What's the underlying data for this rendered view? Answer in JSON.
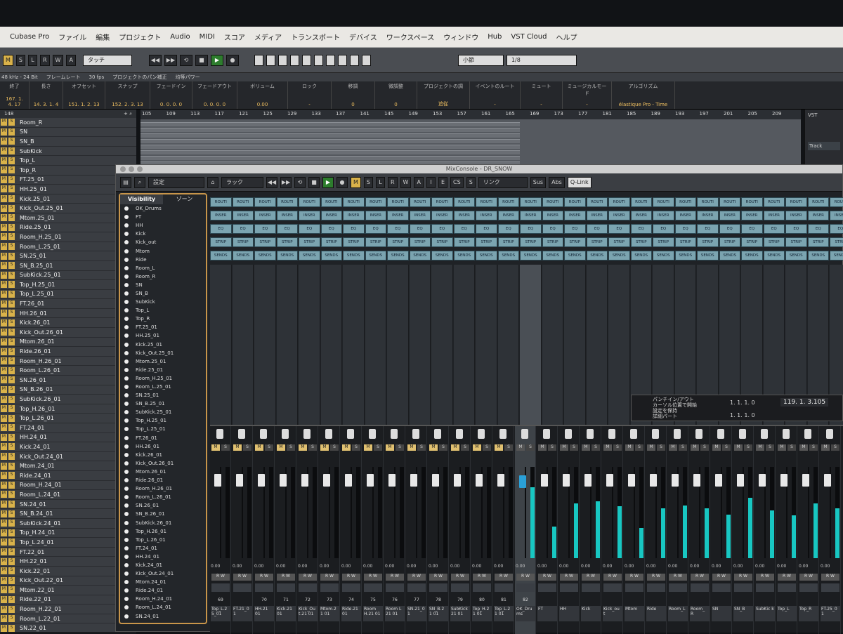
{
  "menubar": {
    "items": [
      "Cubase Pro",
      "ファイル",
      "編集",
      "プロジェクト",
      "Audio",
      "MIDI",
      "スコア",
      "メディア",
      "トランスポート",
      "デバイス",
      "ワークスペース",
      "ウィンドウ",
      "Hub",
      "VST Cloud",
      "ヘルプ"
    ]
  },
  "toolbar": {
    "msrwa": [
      "M",
      "S",
      "L",
      "R",
      "W",
      "A"
    ],
    "mode": "タッチ",
    "quantize": "小節",
    "grid": "1/8"
  },
  "infoline": {
    "items": [
      "48 kHz - 24 Bit",
      "フレームレート",
      "30 fps",
      "プロジェクトのパン補正",
      "均等パワー"
    ]
  },
  "eventline": {
    "cells": [
      {
        "label": "終了",
        "value": "167. 1. 4. 17"
      },
      {
        "label": "長さ",
        "value": "14. 3. 1. 4"
      },
      {
        "label": "オフセット",
        "value": "151. 1. 2. 13"
      },
      {
        "label": "スナップ",
        "value": "152. 2. 3. 13"
      },
      {
        "label": "フェードイン",
        "value": "0. 0. 0. 0"
      },
      {
        "label": "フェードアウト",
        "value": "0. 0. 0. 0"
      },
      {
        "label": "ボリューム",
        "value": "0.00"
      },
      {
        "label": "ロック",
        "value": "-"
      },
      {
        "label": "移調",
        "value": "0"
      },
      {
        "label": "微調整",
        "value": "0"
      },
      {
        "label": "プロジェクトの調",
        "value": "追従"
      },
      {
        "label": "イベントのルート",
        "value": "-"
      },
      {
        "label": "ミュート",
        "value": "-"
      },
      {
        "label": "ミュージカルモード",
        "value": "-"
      },
      {
        "label": "アルゴリズム",
        "value": "élastique Pro - Time"
      }
    ]
  },
  "tracklist": {
    "count": "148",
    "tracks": [
      "Room_R",
      "SN",
      "SN_B",
      "SubKick",
      "Top_L",
      "Top_R",
      "FT.25_01",
      "HH.25_01",
      "Kick.25_01",
      "Kick_Out.25_01",
      "Mtom.25_01",
      "Ride.25_01",
      "Room_H.25_01",
      "Room_L.25_01",
      "SN.25_01",
      "SN_B.25_01",
      "SubKick.25_01",
      "Top_H.25_01",
      "Top_L.25_01",
      "FT.26_01",
      "HH.26_01",
      "Kick.26_01",
      "Kick_Out.26_01",
      "Mtom.26_01",
      "Ride.26_01",
      "Room_H.26_01",
      "Room_L.26_01",
      "SN.26_01",
      "SN_B.26_01",
      "SubKick.26_01",
      "Top_H.26_01",
      "Top_L.26_01",
      "FT.24_01",
      "HH.24_01",
      "Kick.24_01",
      "Kick_Out.24_01",
      "Mtom.24_01",
      "Ride.24_01",
      "Room_H.24_01",
      "Room_L.24_01",
      "SN.24_01",
      "SN_B.24_01",
      "SubKick.24_01",
      "Top_H.24_01",
      "Top_L.24_01",
      "FT.22_01",
      "HH.22_01",
      "Kick.22_01",
      "Kick_Out.22_01",
      "Mtom.22_01",
      "Ride.22_01",
      "Room_H.22_01",
      "Room_L.22_01",
      "SN.22_01"
    ]
  },
  "ruler": {
    "bars": [
      "105",
      "109",
      "113",
      "117",
      "121",
      "125",
      "129",
      "133",
      "137",
      "141",
      "145",
      "149",
      "153",
      "157",
      "161",
      "165",
      "169",
      "173",
      "177",
      "181",
      "185",
      "189",
      "193",
      "197",
      "201",
      "205",
      "209"
    ]
  },
  "rightzone": {
    "title": "VST",
    "button": "Track"
  },
  "mixconsole": {
    "title": "MixConsole - DR_SNOW",
    "toolbar": {
      "settings": "設定",
      "rack": "ラック",
      "btns": [
        "M",
        "S",
        "L",
        "R",
        "W",
        "A"
      ],
      "ies": [
        "I",
        "E",
        "CS",
        "S"
      ],
      "link": "リンク",
      "sus": "Sus",
      "abs": "Abs",
      "qlink": "Q-Link"
    },
    "vis_tabs": [
      "Visibility",
      "ゾーン"
    ],
    "vis_items": [
      "OK_Drums",
      "FT",
      "HH",
      "Kick",
      "Kick_out",
      "Mtom",
      "Ride",
      "Room_L",
      "Room_R",
      "SN",
      "SN_B",
      "SubKick",
      "Top_L",
      "Top_R",
      "FT.25_01",
      "HH.25_01",
      "Kick.25_01",
      "Kick_Out.25_01",
      "Mtom.25_01",
      "Ride.25_01",
      "Room_H.25_01",
      "Room_L.25_01",
      "SN.25_01",
      "SN_B.25_01",
      "SubKick.25_01",
      "Top_H.25_01",
      "Top_L.25_01",
      "FT.26_01",
      "HH.26_01",
      "Kick.26_01",
      "Kick_Out.26_01",
      "Mtom.26_01",
      "Ride.26_01",
      "Room_H.26_01",
      "Room_L.26_01",
      "SN.26_01",
      "SN_B.26_01",
      "SubKick.26_01",
      "Top_H.26_01",
      "Top_L.26_01",
      "FT.24_01",
      "HH.24_01",
      "Kick.24_01",
      "Kick_Out.24_01",
      "Mtom.24_01",
      "Ride.24_01",
      "Room_H.24_01",
      "Room_L.24_01",
      "SN.24_01"
    ],
    "racks": [
      "ROUTI",
      "INSER",
      "EQ",
      "STRIP",
      "SENDS"
    ],
    "channels": [
      {
        "num": "69",
        "name": "Top_L.2 5_01",
        "val": "0.00",
        "meter": 0
      },
      {
        "num": "",
        "name": "FT.21_0 1",
        "val": "0.00",
        "meter": 0
      },
      {
        "num": "70",
        "name": "HH.21 01",
        "val": "0.00",
        "meter": 0
      },
      {
        "num": "71",
        "name": "Kick.21 01",
        "val": "0.00",
        "meter": 0
      },
      {
        "num": "72",
        "name": "Kick_Ou t.21 01",
        "val": "0.00",
        "meter": 0
      },
      {
        "num": "73",
        "name": "Mtom.2 1 01",
        "val": "0.00",
        "meter": 0
      },
      {
        "num": "74",
        "name": "Ride.21 01",
        "val": "0.00",
        "meter": 0
      },
      {
        "num": "75",
        "name": "Room H.21 01",
        "val": "0.00",
        "meter": 0
      },
      {
        "num": "76",
        "name": "Room L 21 01",
        "val": "0.00",
        "meter": 0
      },
      {
        "num": "77",
        "name": "SN.21_0 1",
        "val": "0.00",
        "meter": 0
      },
      {
        "num": "78",
        "name": "SN_B.2 1 01",
        "val": "0.00",
        "meter": 0
      },
      {
        "num": "79",
        "name": "SubKick 21 01",
        "val": "0.00",
        "meter": 0
      },
      {
        "num": "80",
        "name": "Top_H.2 1 01",
        "val": "0.00",
        "meter": 0
      },
      {
        "num": "81",
        "name": "Top_L.2 1 01",
        "val": "0.00",
        "meter": 0
      },
      {
        "num": "82",
        "name": "OK_Dru ms",
        "val": "0.00",
        "meter": 0.78
      },
      {
        "num": "",
        "name": "FT",
        "val": "0.00",
        "meter": 0.35
      },
      {
        "num": "",
        "name": "HH",
        "val": "0.00",
        "meter": 0.6
      },
      {
        "num": "",
        "name": "Kick",
        "val": "0.00",
        "meter": 0.62
      },
      {
        "num": "",
        "name": "Kick_ou t",
        "val": "0.00",
        "meter": 0.57
      },
      {
        "num": "",
        "name": "Mtom",
        "val": "0.00",
        "meter": 0.33
      },
      {
        "num": "",
        "name": "Ride",
        "val": "0.00",
        "meter": 0.55
      },
      {
        "num": "",
        "name": "Room_L",
        "val": "0.00",
        "meter": 0.58
      },
      {
        "num": "",
        "name": "Room_ R",
        "val": "0.00",
        "meter": 0.55
      },
      {
        "num": "",
        "name": "SN",
        "val": "0.00",
        "meter": 0.48
      },
      {
        "num": "",
        "name": "SN_B",
        "val": "0.00",
        "meter": 0.66
      },
      {
        "num": "",
        "name": "SubKic k",
        "val": "0.00",
        "meter": 0.52
      },
      {
        "num": "",
        "name": "Top_L",
        "val": "0.00",
        "meter": 0.47
      },
      {
        "num": "",
        "name": "Top_R",
        "val": "0.00",
        "meter": 0.6
      },
      {
        "num": "",
        "name": "FT.25_0 1",
        "val": "0.00",
        "meter": 0.55
      }
    ],
    "popup": {
      "lines": [
        "パンチイン/アウト",
        "カーソル位置で開始",
        "設定を保持",
        "詳細パート"
      ],
      "pos1": "1. 1. 1. 0",
      "pos2": "1. 1. 1. 0",
      "time": "119. 1. 3.105"
    }
  }
}
